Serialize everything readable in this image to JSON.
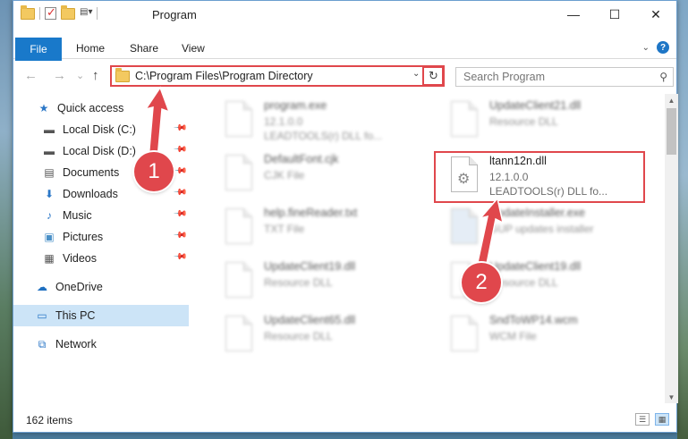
{
  "window": {
    "title": "Program",
    "controls": {
      "minimize": "—",
      "maximize": "☐",
      "close": "✕"
    }
  },
  "ribbon": {
    "tabs": [
      "File",
      "Home",
      "Share",
      "View"
    ]
  },
  "nav": {
    "back": "←",
    "forward": "→",
    "recent": "⌄",
    "up": "↑",
    "address": "C:\\Program Files\\Program Directory",
    "search_placeholder": "Search Program"
  },
  "sidebar": {
    "items": [
      {
        "label": "Quick access",
        "icon": "star-icon",
        "glyph": "★",
        "color": "#2b77c7"
      },
      {
        "label": "Local Disk (C:)",
        "icon": "drive-icon",
        "glyph": "▬",
        "color": "#555"
      },
      {
        "label": "Local Disk (D:)",
        "icon": "drive-icon",
        "glyph": "▬",
        "color": "#555"
      },
      {
        "label": "Documents",
        "icon": "documents-icon",
        "glyph": "▤",
        "color": "#555"
      },
      {
        "label": "Downloads",
        "icon": "download-icon",
        "glyph": "⬇",
        "color": "#2b77c7"
      },
      {
        "label": "Music",
        "icon": "music-icon",
        "glyph": "♪",
        "color": "#2b77c7"
      },
      {
        "label": "Pictures",
        "icon": "pictures-icon",
        "glyph": "▣",
        "color": "#4a90c7"
      },
      {
        "label": "Videos",
        "icon": "videos-icon",
        "glyph": "▦",
        "color": "#555"
      },
      {
        "label": "OneDrive",
        "icon": "cloud-icon",
        "glyph": "☁",
        "color": "#1e6fc0"
      },
      {
        "label": "This PC",
        "icon": "computer-icon",
        "glyph": "▭",
        "color": "#2b77c7"
      },
      {
        "label": "Network",
        "icon": "network-icon",
        "glyph": "⧉",
        "color": "#2b77c7"
      }
    ]
  },
  "files": [
    {
      "name": "program.exe",
      "line2": "12.1.0.0",
      "line3": "LEADTOOLS(r) DLL fo..."
    },
    {
      "name": "UpdateClient21.dll",
      "line2": "Resource DLL",
      "line3": ""
    },
    {
      "name": "DefaultFont.cjk",
      "line2": "CJK File",
      "line3": ""
    },
    {
      "name": "ltann12n.dll",
      "line2": "12.1.0.0",
      "line3": "LEADTOOLS(r) DLL fo..."
    },
    {
      "name": "help.fineReader.txt",
      "line2": "TXT File",
      "line3": ""
    },
    {
      "name": "UpdateInstaller.exe",
      "line2": "GUP updates installer",
      "line3": ""
    },
    {
      "name": "UpdateClient19.dll",
      "line2": "Resource DLL",
      "line3": ""
    },
    {
      "name": "UpdateClient19.dll",
      "line2": "Resource DLL",
      "line3": ""
    },
    {
      "name": "UpdateClient65.dll",
      "line2": "Resource DLL",
      "line3": ""
    },
    {
      "name": "SndToWP14.wcm",
      "line2": "WCM File",
      "line3": ""
    }
  ],
  "status": {
    "item_count": "162 items"
  },
  "annotations": {
    "step1": "1",
    "step2": "2",
    "accent": "#e0474c"
  }
}
